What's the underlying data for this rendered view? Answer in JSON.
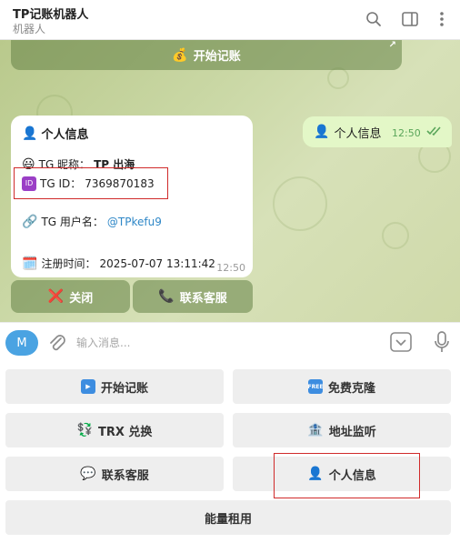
{
  "header": {
    "title": "TP记账机器人",
    "subtitle": "机器人",
    "icons": [
      "search-icon",
      "side-panel-icon",
      "more-vert-icon"
    ]
  },
  "chat": {
    "top_button": {
      "icon": "💰",
      "label": "开始记账"
    },
    "outgoing": {
      "icon": "👤",
      "text": "个人信息",
      "time": "12:50",
      "status": "read"
    },
    "incoming": {
      "title_icon": "👤",
      "title": "个人信息",
      "nickname_icon": "😃",
      "nickname_label": "TG 昵称：",
      "nickname_value": "TP 出海",
      "id_icon": "🆔",
      "id_label": "TG ID：",
      "id_value": "7369870183",
      "username_icon": "🔗",
      "username_label": "TG 用户名：",
      "username_value": "@TPkefu9",
      "reg_icon": "🗓️",
      "reg_label": "注册时间：",
      "reg_value": "2025-07-07 13:11:42",
      "time": "12:50"
    },
    "inline_buttons": [
      {
        "icon": "❌",
        "label": "关闭"
      },
      {
        "icon": "📞",
        "label": "联系客服"
      }
    ]
  },
  "input": {
    "avatar_letter": "M",
    "placeholder": "输入消息..."
  },
  "keyboard": {
    "row1": [
      {
        "icon": "▶️",
        "label": "开始记账"
      },
      {
        "icon": "🆓",
        "label": "免费克隆"
      }
    ],
    "row2": [
      {
        "icon": "💱",
        "label": "TRX 兑换"
      },
      {
        "icon": "🏦",
        "label": "地址监听"
      }
    ],
    "row3": [
      {
        "icon": "💬",
        "label": "联系客服"
      },
      {
        "icon": "👤",
        "label": "个人信息"
      }
    ],
    "row4": [
      {
        "label": "能量租用"
      }
    ]
  },
  "colors": {
    "accent_blue": "#4aa3e2",
    "highlight_red": "#d02a2a",
    "outgoing_bubble": "#e3f7c7",
    "chat_bg": "#c9d7a4"
  }
}
